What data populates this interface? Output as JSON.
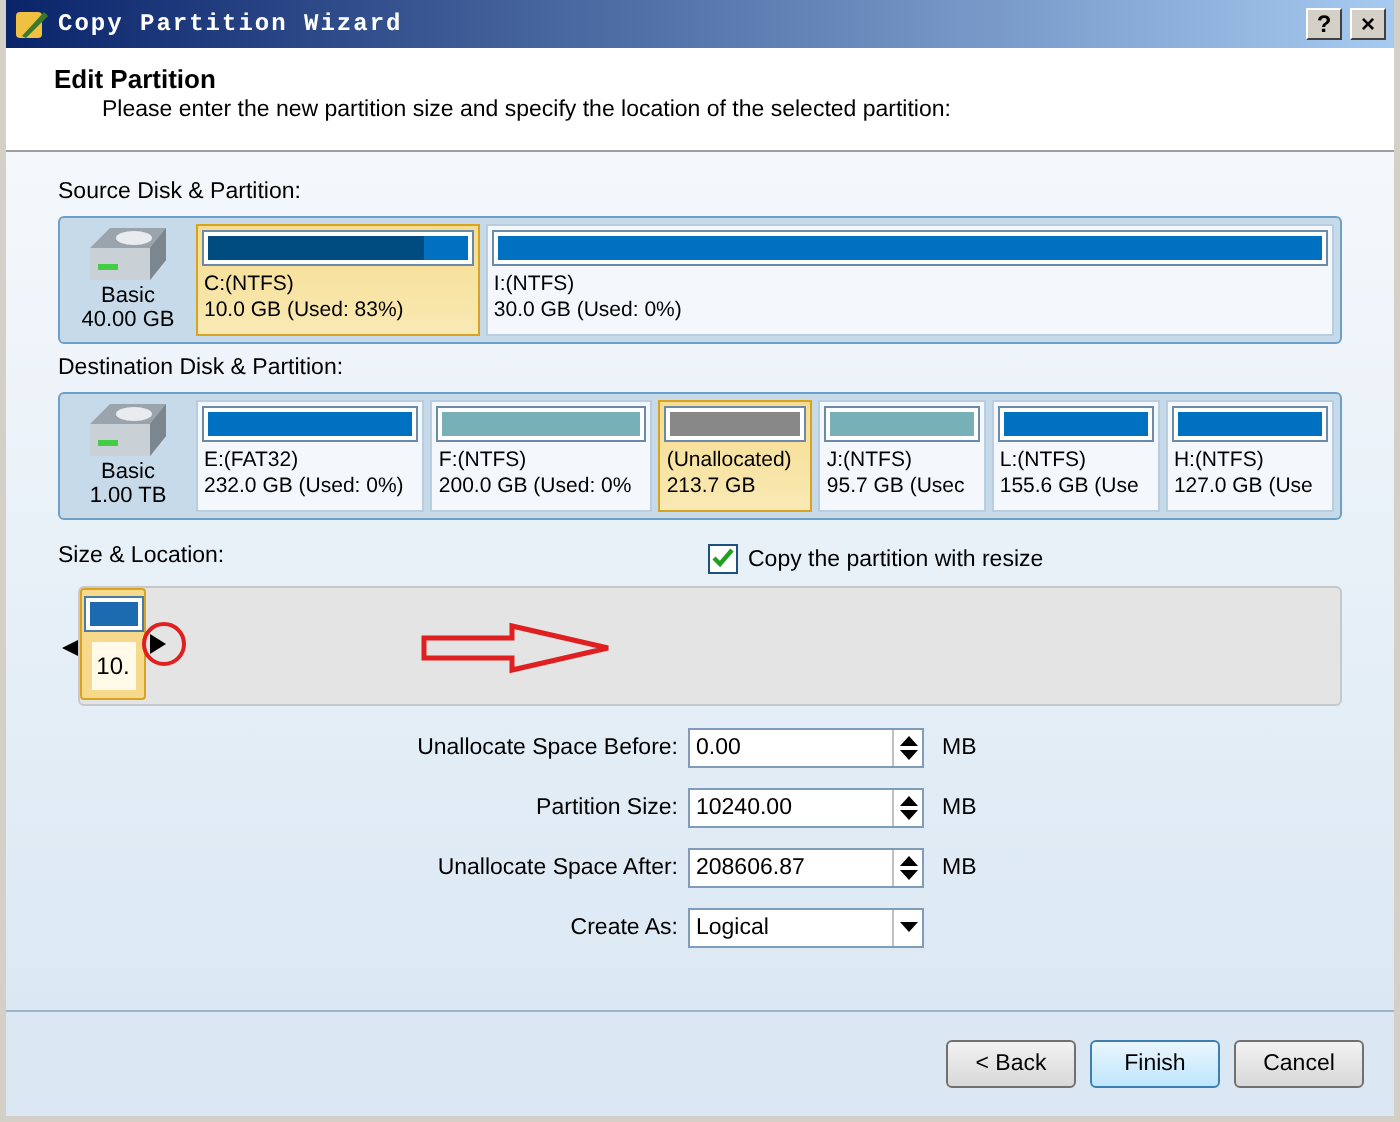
{
  "window": {
    "title": "Copy Partition Wizard",
    "buttons": [
      "?",
      "×"
    ]
  },
  "header": {
    "title": "Edit Partition",
    "subtitle": "Please enter the new partition size and specify the location of the selected partition:"
  },
  "source": {
    "label": "Source Disk & Partition:",
    "disk": {
      "type": "Basic",
      "size": "40.00 GB"
    },
    "partitions": [
      {
        "name": "C:(NTFS)",
        "detail": "10.0 GB (Used: 83%)",
        "selected": true,
        "color": "#0070c0",
        "level": 0.83
      },
      {
        "name": "I:(NTFS)",
        "detail": "30.0 GB (Used: 0%)",
        "selected": false,
        "color": "#0070c0"
      }
    ]
  },
  "destination": {
    "label": "Destination Disk & Partition:",
    "disk": {
      "type": "Basic",
      "size": "1.00 TB"
    },
    "partitions": [
      {
        "name": "E:(FAT32)",
        "detail": "232.0 GB (Used: 0%)",
        "selected": false,
        "color": "#0070c0"
      },
      {
        "name": "F:(NTFS)",
        "detail": "200.0 GB (Used: 0%",
        "selected": false,
        "color": "#78b0b8"
      },
      {
        "name": "(Unallocated)",
        "detail": "213.7 GB",
        "selected": true,
        "color": "#888888"
      },
      {
        "name": "J:(NTFS)",
        "detail": "95.7 GB (Usec",
        "selected": false,
        "color": "#78b0b8"
      },
      {
        "name": "L:(NTFS)",
        "detail": "155.6 GB (Use",
        "selected": false,
        "color": "#0070c0"
      },
      {
        "name": "H:(NTFS)",
        "detail": "127.0 GB (Use",
        "selected": false,
        "color": "#0070c0"
      }
    ]
  },
  "size_location": {
    "label": "Size & Location:",
    "resize": {
      "label": "Copy the partition with resize",
      "checked": true
    },
    "block_text": "10."
  },
  "fields": [
    {
      "kind": "spin",
      "label": "Unallocate Space Before:",
      "value": "0.00",
      "unit": "MB"
    },
    {
      "kind": "spin",
      "label": "Partition Size:",
      "value": "10240.00",
      "unit": "MB"
    },
    {
      "kind": "spin",
      "label": "Unallocate Space After:",
      "value": "208606.87",
      "unit": "MB"
    },
    {
      "kind": "dropdown",
      "label": "Create As:",
      "value": "Logical"
    }
  ],
  "buttons": [
    {
      "label": "< Back",
      "default": false
    },
    {
      "label": "Finish",
      "default": true
    },
    {
      "label": "Cancel",
      "default": false
    }
  ]
}
